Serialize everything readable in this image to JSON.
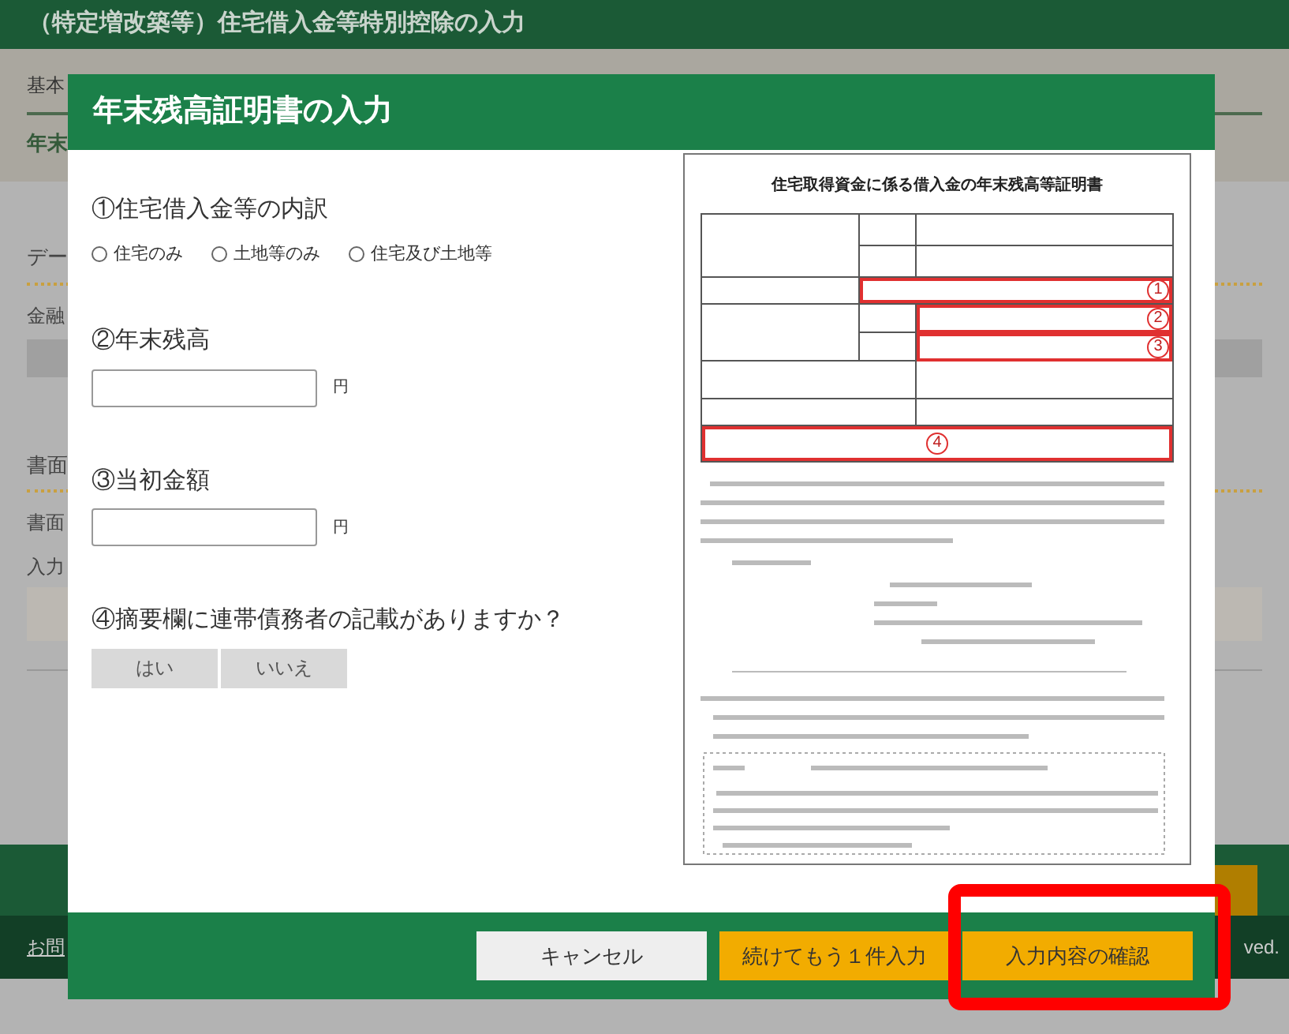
{
  "app_bar": {
    "title": "（特定増改築等）住宅借入金等特別控除の入力"
  },
  "background": {
    "breadcrumb": "基本",
    "page_heading": "年末",
    "section_1_heading": "デー",
    "section_1_label": "金融",
    "section_2_heading": "書面",
    "section_2_label_1": "書面",
    "section_2_label_2": "入力",
    "footer_link": "お問",
    "footer_copyright": "ved."
  },
  "dialog": {
    "title": "年末残高証明書の入力",
    "questions": [
      {
        "kind": "radio",
        "label": "①住宅借入金等の内訳",
        "options": [
          {
            "label": "住宅のみ",
            "selected": false
          },
          {
            "label": "土地等のみ",
            "selected": false
          },
          {
            "label": "住宅及び土地等",
            "selected": false
          }
        ]
      },
      {
        "kind": "amount",
        "label": "②年末残高",
        "unit": "円"
      },
      {
        "kind": "amount",
        "label": "③当初金額",
        "unit": "円"
      },
      {
        "kind": "yes_no",
        "label": "④摘要欄に連帯債務者の記載がありますか？",
        "options": [
          {
            "label": "はい",
            "selected": false
          },
          {
            "label": "いいえ",
            "selected": false
          }
        ]
      }
    ],
    "document": {
      "title": "住宅取得資金に係る借入金の年末残高等証明書",
      "callouts": [
        "1",
        "2",
        "3",
        "4"
      ]
    },
    "buttons": [
      {
        "label": "キャンセル",
        "kind": "secondary",
        "highlighted": false
      },
      {
        "label": "続けてもう１件入力",
        "kind": "primary",
        "highlighted": false
      },
      {
        "label": "入力内容の確認",
        "kind": "primary",
        "highlighted": true
      }
    ]
  }
}
